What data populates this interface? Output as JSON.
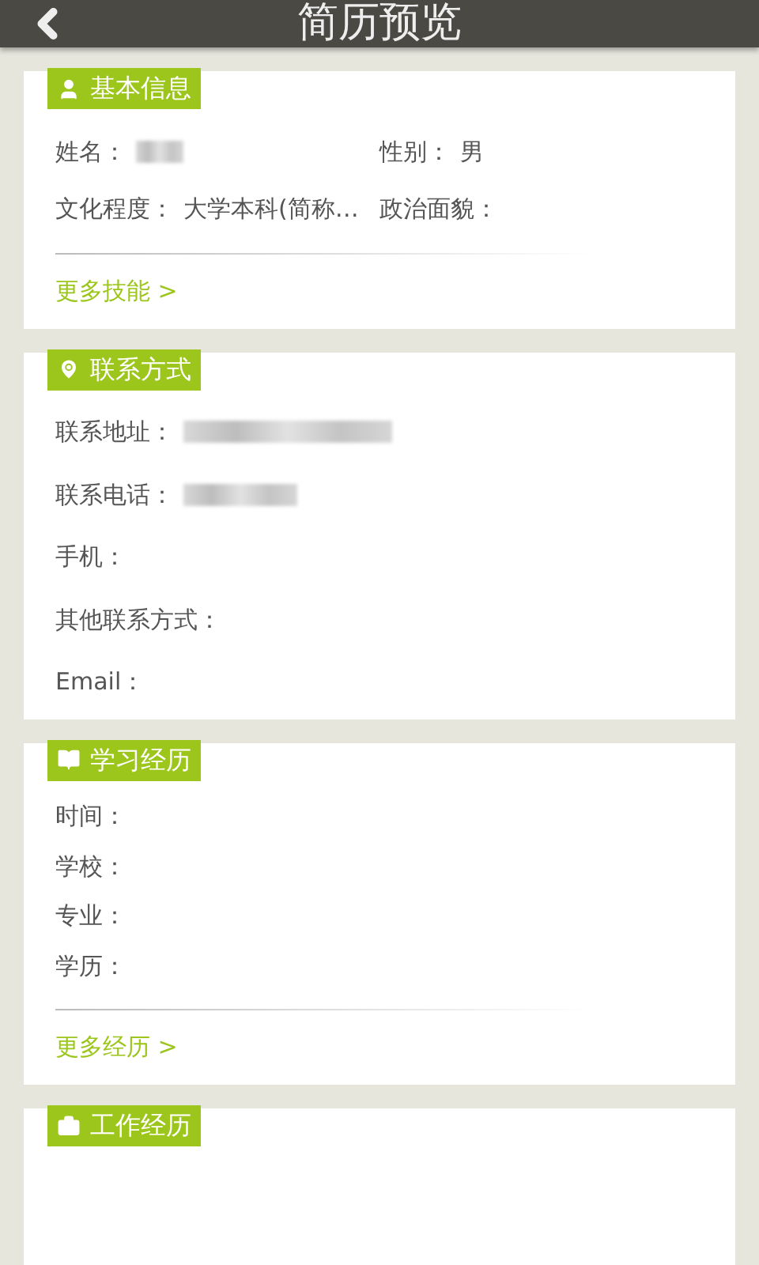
{
  "header": {
    "title": "简历预览"
  },
  "sections": [
    {
      "title": "基本信息",
      "kind": "grid",
      "fields": [
        {
          "label": "姓名：",
          "redacted": true
        },
        {
          "label": "性别：",
          "value": "男"
        },
        {
          "label": "文化程度：",
          "value": "大学本科(简称…"
        },
        {
          "label": "政治面貌："
        }
      ],
      "more": "更多技能 >"
    },
    {
      "title": "联系方式",
      "kind": "list",
      "fields": [
        {
          "label": "联系地址：",
          "redacted": true
        },
        {
          "label": "联系电话：",
          "redacted": true
        },
        {
          "label": "手机："
        },
        {
          "label": "其他联系方式："
        },
        {
          "label": "Email："
        }
      ]
    },
    {
      "title": "学习经历",
      "kind": "compact",
      "fields": [
        {
          "label": "时间："
        },
        {
          "label": "学校："
        },
        {
          "label": "专业："
        },
        {
          "label": "学历："
        }
      ],
      "more": "更多经历 >"
    },
    {
      "title": "工作经历",
      "kind": "list"
    }
  ]
}
